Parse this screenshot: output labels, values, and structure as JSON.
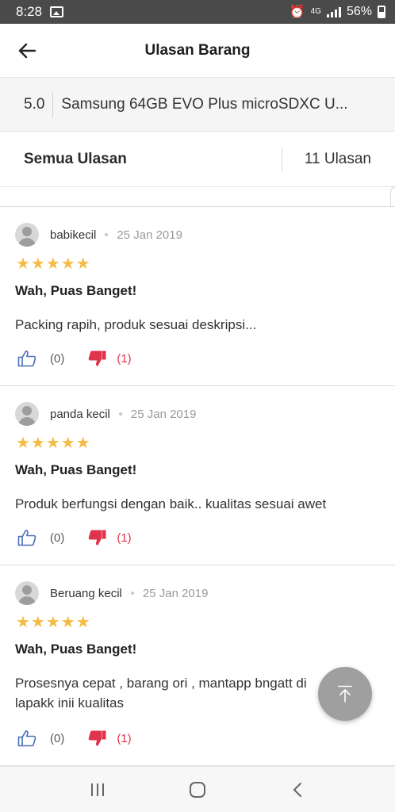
{
  "status_bar": {
    "time": "8:28",
    "network": "4G",
    "battery": "56%"
  },
  "app_bar": {
    "title": "Ulasan Barang"
  },
  "product": {
    "rating": "5.0",
    "name": "Samsung 64GB EVO Plus microSDXC U..."
  },
  "filter": {
    "label": "Semua Ulasan",
    "count": "11 Ulasan"
  },
  "reviews": [
    {
      "user": "babikecil",
      "date": "25 Jan 2019",
      "stars": "★★★★★",
      "title": "Wah, Puas Banget!",
      "body": "Packing rapih, produk sesuai deskripsi...",
      "likes": "(0)",
      "dislikes": "(1)"
    },
    {
      "user": "panda kecil",
      "date": "25 Jan 2019",
      "stars": "★★★★★",
      "title": "Wah, Puas Banget!",
      "body": "Produk berfungsi dengan baik.. kualitas sesuai awet",
      "likes": "(0)",
      "dislikes": "(1)"
    },
    {
      "user": "Beruang kecil",
      "date": "25 Jan 2019",
      "stars": "★★★★★",
      "title": "Wah, Puas Banget!",
      "body": "Prosesnya cepat , barang ori , mantapp bngatt di lapakk inii  kualitas",
      "likes": "(0)",
      "dislikes": "(1)"
    }
  ],
  "colors": {
    "star": "#f5bb44",
    "dislike": "#e0334c",
    "fab": "#9f9f9f"
  },
  "icons": [
    "back-arrow-icon",
    "thumbs-up-icon",
    "thumbs-down-icon",
    "scroll-to-top-icon",
    "recent-apps-icon",
    "home-icon",
    "nav-back-icon"
  ]
}
